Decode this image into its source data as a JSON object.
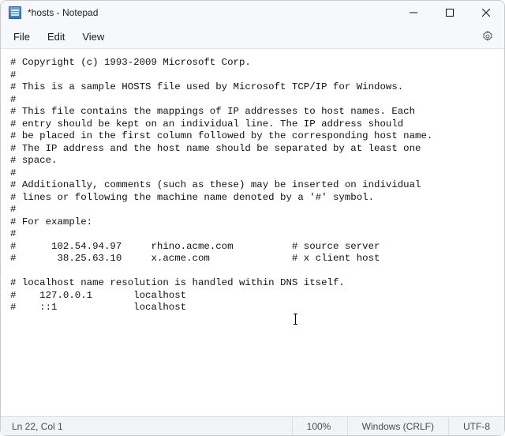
{
  "window": {
    "title": "*hosts - Notepad"
  },
  "menubar": {
    "file": "File",
    "edit": "Edit",
    "view": "View"
  },
  "editor": {
    "content": "# Copyright (c) 1993-2009 Microsoft Corp.\n#\n# This is a sample HOSTS file used by Microsoft TCP/IP for Windows.\n#\n# This file contains the mappings of IP addresses to host names. Each\n# entry should be kept on an individual line. The IP address should\n# be placed in the first column followed by the corresponding host name.\n# The IP address and the host name should be separated by at least one\n# space.\n#\n# Additionally, comments (such as these) may be inserted on individual\n# lines or following the machine name denoted by a '#' symbol.\n#\n# For example:\n#\n#      102.54.94.97     rhino.acme.com          # source server\n#       38.25.63.10     x.acme.com              # x client host\n\n# localhost name resolution is handled within DNS itself.\n#    127.0.0.1       localhost\n#    ::1             localhost"
  },
  "statusbar": {
    "position": "Ln 22, Col 1",
    "zoom": "100%",
    "line_ending": "Windows (CRLF)",
    "encoding": "UTF-8"
  }
}
